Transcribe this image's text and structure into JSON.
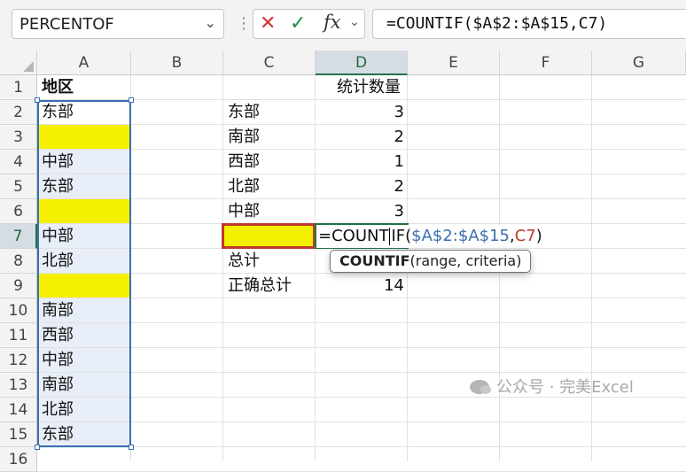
{
  "name_box": {
    "value": "PERCENTOF",
    "dropdown_icon": "chevron-down-icon"
  },
  "formula_bar": {
    "cancel_icon": "✕",
    "enter_icon": "✓",
    "fx_label": "fx",
    "formula": "=COUNTIF($A$2:$A$15,C7)"
  },
  "columns": [
    "A",
    "B",
    "C",
    "D",
    "E",
    "F",
    "G"
  ],
  "selected_column": "D",
  "rows": [
    "1",
    "2",
    "3",
    "4",
    "5",
    "6",
    "7",
    "8",
    "9",
    "10",
    "11",
    "12",
    "13",
    "14",
    "15",
    "16"
  ],
  "selected_row": "7",
  "cells": {
    "A1": "地区",
    "A2": "东部",
    "A3": "",
    "A4": "中部",
    "A5": "东部",
    "A6": "",
    "A7": "中部",
    "A8": "北部",
    "A9": "",
    "A10": "南部",
    "A11": "西部",
    "A12": "中部",
    "A13": "南部",
    "A14": "北部",
    "A15": "东部",
    "D1": "统计数量",
    "C2": "东部",
    "D2": "3",
    "C3": "南部",
    "D3": "2",
    "C4": "西部",
    "D4": "1",
    "C5": "北部",
    "D5": "2",
    "C6": "中部",
    "D6": "3",
    "C8": "总计",
    "C9": "正确总计",
    "D9": "14"
  },
  "edit": {
    "prefix": "=COUNT",
    "suffix": "IF(",
    "range_ref": "$A$2:$A$15",
    "comma": ",",
    "cell_ref": "C7",
    "close": ")"
  },
  "tooltip": {
    "func": "COUNTIF",
    "args": "(range, criteria)"
  },
  "watermark": {
    "text": "公众号 · 完美Excel"
  },
  "colors": {
    "accent": "#217346",
    "range_ref": "#3a6fb0",
    "cell_ref": "#c0392b",
    "highlight": "#f4f000",
    "range_fill": "#e8eef7"
  }
}
